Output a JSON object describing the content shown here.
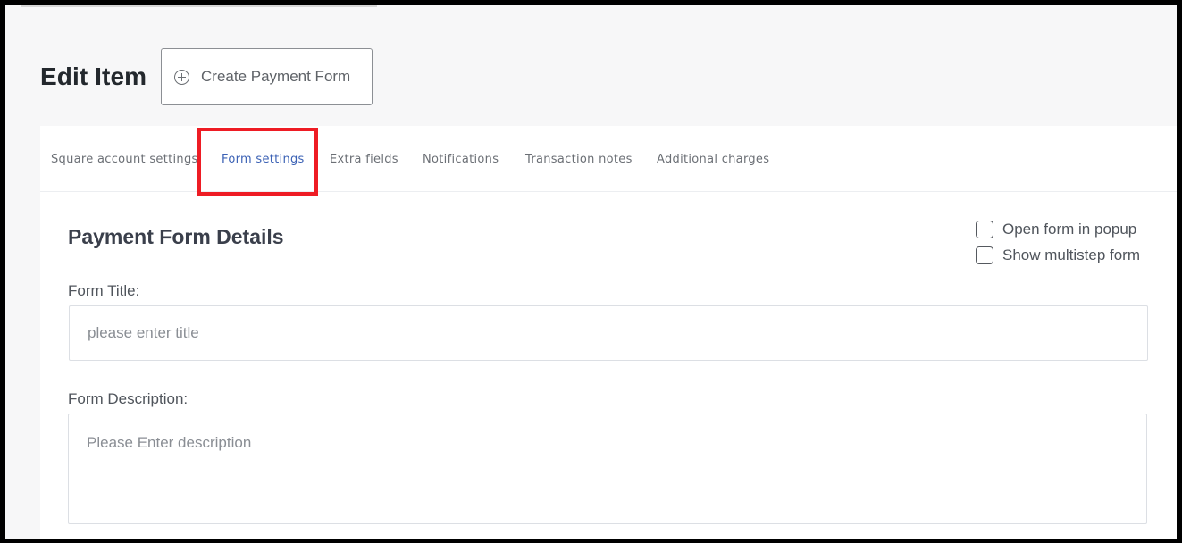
{
  "header": {
    "title": "Edit Item",
    "create_button_label": "Create Payment Form",
    "create_button_icon": "plus-circle-icon"
  },
  "tabs": [
    {
      "label": "Square account settings",
      "active": false
    },
    {
      "label": "Form settings",
      "active": true
    },
    {
      "label": "Extra fields",
      "active": false
    },
    {
      "label": "Notifications",
      "active": false
    },
    {
      "label": "Transaction notes",
      "active": false
    },
    {
      "label": "Additional charges",
      "active": false
    }
  ],
  "form": {
    "section_title": "Payment Form Details",
    "options": {
      "popup_label": "Open form in popup",
      "popup_checked": false,
      "multistep_label": "Show multistep form",
      "multistep_checked": false
    },
    "title_label": "Form Title:",
    "title_value": "",
    "title_placeholder": "please enter title",
    "description_label": "Form Description:",
    "description_value": "",
    "description_placeholder": "Please Enter description"
  },
  "colors": {
    "active_tab": "#3c62b5",
    "highlight": "#ee1c24"
  }
}
